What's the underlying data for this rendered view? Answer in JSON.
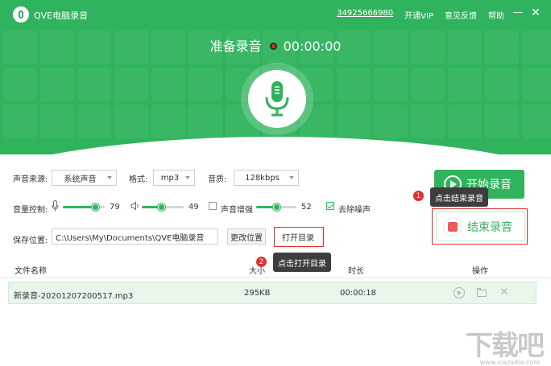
{
  "app": {
    "title": "QVE电脑录音"
  },
  "topbar": {
    "phone": "34925666980",
    "vip": "开通VIP",
    "feedback": "意见反馈",
    "help": "帮助",
    "minimize": "—",
    "close": "✕"
  },
  "status": {
    "label": "准备录音",
    "timer": "00:00:00"
  },
  "settings": {
    "source_label": "声音来源:",
    "source_value": "系统声音",
    "format_label": "格式:",
    "format_value": "mp3",
    "quality_label": "音质:",
    "quality_value": "128kbps",
    "volume_label": "音量控制:",
    "mic_volume": 79,
    "speaker_volume": 49,
    "enhance_label": "声音增强",
    "enhance_checked": false,
    "enhance_value": 52,
    "denoise_label": "去除噪声",
    "denoise_checked": true,
    "save_label": "保存位置:",
    "save_path": "C:\\Users\\My\\Documents\\QVE电脑录音",
    "change_btn": "更改位置",
    "open_btn": "打开目录"
  },
  "actions": {
    "start": "开始录音",
    "stop": "结束录音"
  },
  "tips": [
    {
      "num": "1",
      "text": "点击结束录音"
    },
    {
      "num": "2",
      "text": "点击打开目录"
    }
  ],
  "table": {
    "headers": {
      "name": "文件名称",
      "size": "大小",
      "duration": "时长",
      "ops": "操作"
    },
    "rows": [
      {
        "name": "新录音-20201207200517.mp3",
        "size": "295KB",
        "duration": "00:00:18"
      }
    ]
  },
  "watermark": {
    "text": "下载吧",
    "sub": "www.xiazaiba.com"
  },
  "colors": {
    "brand": "#2fb45d",
    "danger": "#e0302f",
    "tip_bg": "#3d3d3d"
  },
  "icons": [
    "microphone-icon",
    "speaker-icon",
    "play-icon",
    "stop-icon",
    "folder-icon",
    "delete-icon"
  ]
}
